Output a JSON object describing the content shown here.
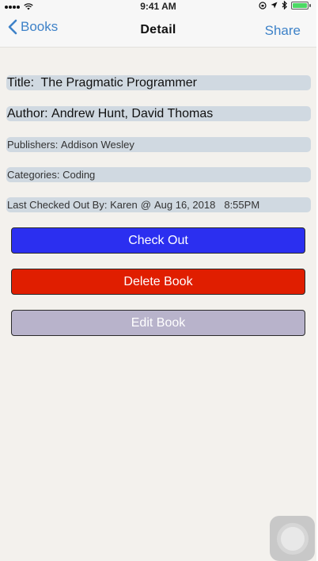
{
  "status_bar": {
    "time": "9:41 AM",
    "left_icons": [
      "signal-dots-icon",
      "wifi-icon"
    ],
    "right_icons": [
      "orientation-lock-icon",
      "location-icon",
      "bluetooth-icon",
      "battery-icon"
    ],
    "battery_level": 1.0
  },
  "nav": {
    "back_label": "Books",
    "title": "Detail",
    "share_label": "Share",
    "tint_color": "#3e82c8"
  },
  "book": {
    "title_label": "Title: ",
    "title": "The Pragmatic Programmer",
    "author_label": "Author: ",
    "author": "Andrew Hunt, David Thomas",
    "publishers_label": "Publishers: ",
    "publishers": "Addison Wesley",
    "categories_label": "Categories: ",
    "categories": "Coding",
    "checkout_label": "Last Checked Out By: ",
    "checkout_user": "Karen",
    "checkout_at": "@",
    "checkout_date": "Aug 16, 2018",
    "checkout_time": "8:55PM"
  },
  "actions": {
    "check_out": {
      "label": "Check Out",
      "color": "#2b2ff0"
    },
    "delete": {
      "label": "Delete Book",
      "color": "#e01e00"
    },
    "edit": {
      "label": "Edit Book",
      "color": "#b8b3cb"
    }
  },
  "colors": {
    "background": "#f3f1ed",
    "field_background": "#d0d9e1"
  }
}
